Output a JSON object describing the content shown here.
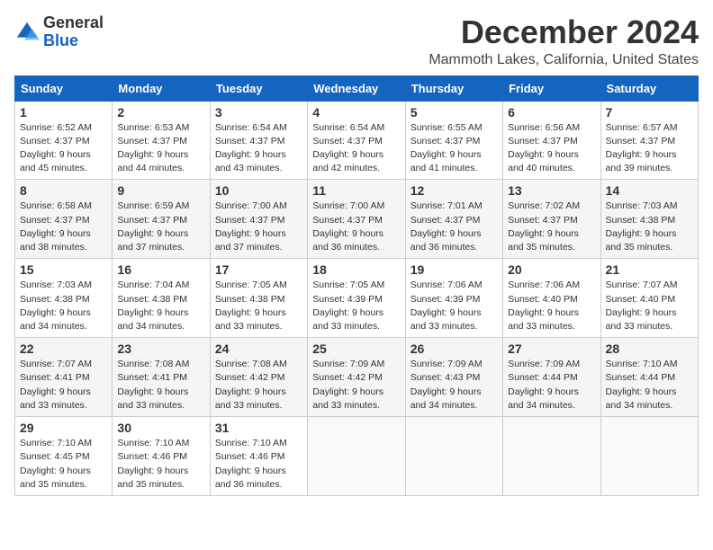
{
  "logo": {
    "general": "General",
    "blue": "Blue"
  },
  "header": {
    "month": "December 2024",
    "location": "Mammoth Lakes, California, United States"
  },
  "weekdays": [
    "Sunday",
    "Monday",
    "Tuesday",
    "Wednesday",
    "Thursday",
    "Friday",
    "Saturday"
  ],
  "weeks": [
    [
      {
        "day": "1",
        "sunrise": "6:52 AM",
        "sunset": "4:37 PM",
        "daylight": "9 hours and 45 minutes."
      },
      {
        "day": "2",
        "sunrise": "6:53 AM",
        "sunset": "4:37 PM",
        "daylight": "9 hours and 44 minutes."
      },
      {
        "day": "3",
        "sunrise": "6:54 AM",
        "sunset": "4:37 PM",
        "daylight": "9 hours and 43 minutes."
      },
      {
        "day": "4",
        "sunrise": "6:54 AM",
        "sunset": "4:37 PM",
        "daylight": "9 hours and 42 minutes."
      },
      {
        "day": "5",
        "sunrise": "6:55 AM",
        "sunset": "4:37 PM",
        "daylight": "9 hours and 41 minutes."
      },
      {
        "day": "6",
        "sunrise": "6:56 AM",
        "sunset": "4:37 PM",
        "daylight": "9 hours and 40 minutes."
      },
      {
        "day": "7",
        "sunrise": "6:57 AM",
        "sunset": "4:37 PM",
        "daylight": "9 hours and 39 minutes."
      }
    ],
    [
      {
        "day": "8",
        "sunrise": "6:58 AM",
        "sunset": "4:37 PM",
        "daylight": "9 hours and 38 minutes."
      },
      {
        "day": "9",
        "sunrise": "6:59 AM",
        "sunset": "4:37 PM",
        "daylight": "9 hours and 37 minutes."
      },
      {
        "day": "10",
        "sunrise": "7:00 AM",
        "sunset": "4:37 PM",
        "daylight": "9 hours and 37 minutes."
      },
      {
        "day": "11",
        "sunrise": "7:00 AM",
        "sunset": "4:37 PM",
        "daylight": "9 hours and 36 minutes."
      },
      {
        "day": "12",
        "sunrise": "7:01 AM",
        "sunset": "4:37 PM",
        "daylight": "9 hours and 36 minutes."
      },
      {
        "day": "13",
        "sunrise": "7:02 AM",
        "sunset": "4:37 PM",
        "daylight": "9 hours and 35 minutes."
      },
      {
        "day": "14",
        "sunrise": "7:03 AM",
        "sunset": "4:38 PM",
        "daylight": "9 hours and 35 minutes."
      }
    ],
    [
      {
        "day": "15",
        "sunrise": "7:03 AM",
        "sunset": "4:38 PM",
        "daylight": "9 hours and 34 minutes."
      },
      {
        "day": "16",
        "sunrise": "7:04 AM",
        "sunset": "4:38 PM",
        "daylight": "9 hours and 34 minutes."
      },
      {
        "day": "17",
        "sunrise": "7:05 AM",
        "sunset": "4:38 PM",
        "daylight": "9 hours and 33 minutes."
      },
      {
        "day": "18",
        "sunrise": "7:05 AM",
        "sunset": "4:39 PM",
        "daylight": "9 hours and 33 minutes."
      },
      {
        "day": "19",
        "sunrise": "7:06 AM",
        "sunset": "4:39 PM",
        "daylight": "9 hours and 33 minutes."
      },
      {
        "day": "20",
        "sunrise": "7:06 AM",
        "sunset": "4:40 PM",
        "daylight": "9 hours and 33 minutes."
      },
      {
        "day": "21",
        "sunrise": "7:07 AM",
        "sunset": "4:40 PM",
        "daylight": "9 hours and 33 minutes."
      }
    ],
    [
      {
        "day": "22",
        "sunrise": "7:07 AM",
        "sunset": "4:41 PM",
        "daylight": "9 hours and 33 minutes."
      },
      {
        "day": "23",
        "sunrise": "7:08 AM",
        "sunset": "4:41 PM",
        "daylight": "9 hours and 33 minutes."
      },
      {
        "day": "24",
        "sunrise": "7:08 AM",
        "sunset": "4:42 PM",
        "daylight": "9 hours and 33 minutes."
      },
      {
        "day": "25",
        "sunrise": "7:09 AM",
        "sunset": "4:42 PM",
        "daylight": "9 hours and 33 minutes."
      },
      {
        "day": "26",
        "sunrise": "7:09 AM",
        "sunset": "4:43 PM",
        "daylight": "9 hours and 34 minutes."
      },
      {
        "day": "27",
        "sunrise": "7:09 AM",
        "sunset": "4:44 PM",
        "daylight": "9 hours and 34 minutes."
      },
      {
        "day": "28",
        "sunrise": "7:10 AM",
        "sunset": "4:44 PM",
        "daylight": "9 hours and 34 minutes."
      }
    ],
    [
      {
        "day": "29",
        "sunrise": "7:10 AM",
        "sunset": "4:45 PM",
        "daylight": "9 hours and 35 minutes."
      },
      {
        "day": "30",
        "sunrise": "7:10 AM",
        "sunset": "4:46 PM",
        "daylight": "9 hours and 35 minutes."
      },
      {
        "day": "31",
        "sunrise": "7:10 AM",
        "sunset": "4:46 PM",
        "daylight": "9 hours and 36 minutes."
      },
      null,
      null,
      null,
      null
    ]
  ],
  "labels": {
    "sunrise": "Sunrise:",
    "sunset": "Sunset:",
    "daylight": "Daylight:"
  }
}
